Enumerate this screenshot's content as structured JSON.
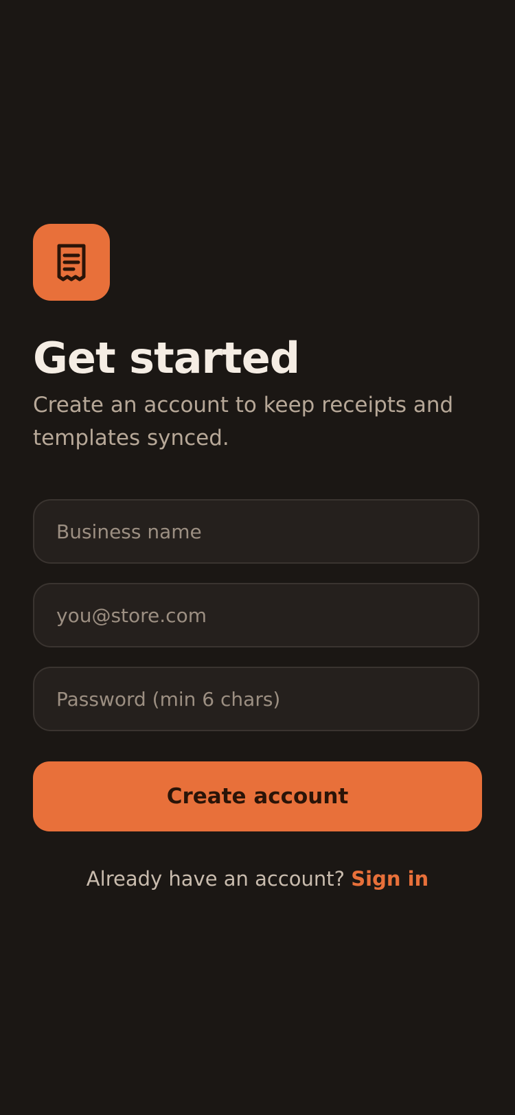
{
  "app": {
    "logo_icon": "receipt-icon",
    "accent_color": "#e8703a",
    "background_color": "#1b1714"
  },
  "header": {
    "title": "Get started",
    "subtitle": "Create an account to keep receipts and templates synced."
  },
  "form": {
    "business_name": {
      "placeholder": "Business name",
      "value": ""
    },
    "email": {
      "placeholder": "you@store.com",
      "value": ""
    },
    "password": {
      "placeholder": "Password (min 6 chars)",
      "value": ""
    },
    "submit_label": "Create account"
  },
  "footer": {
    "prompt": "Already have an account?",
    "link_label": "Sign in"
  }
}
